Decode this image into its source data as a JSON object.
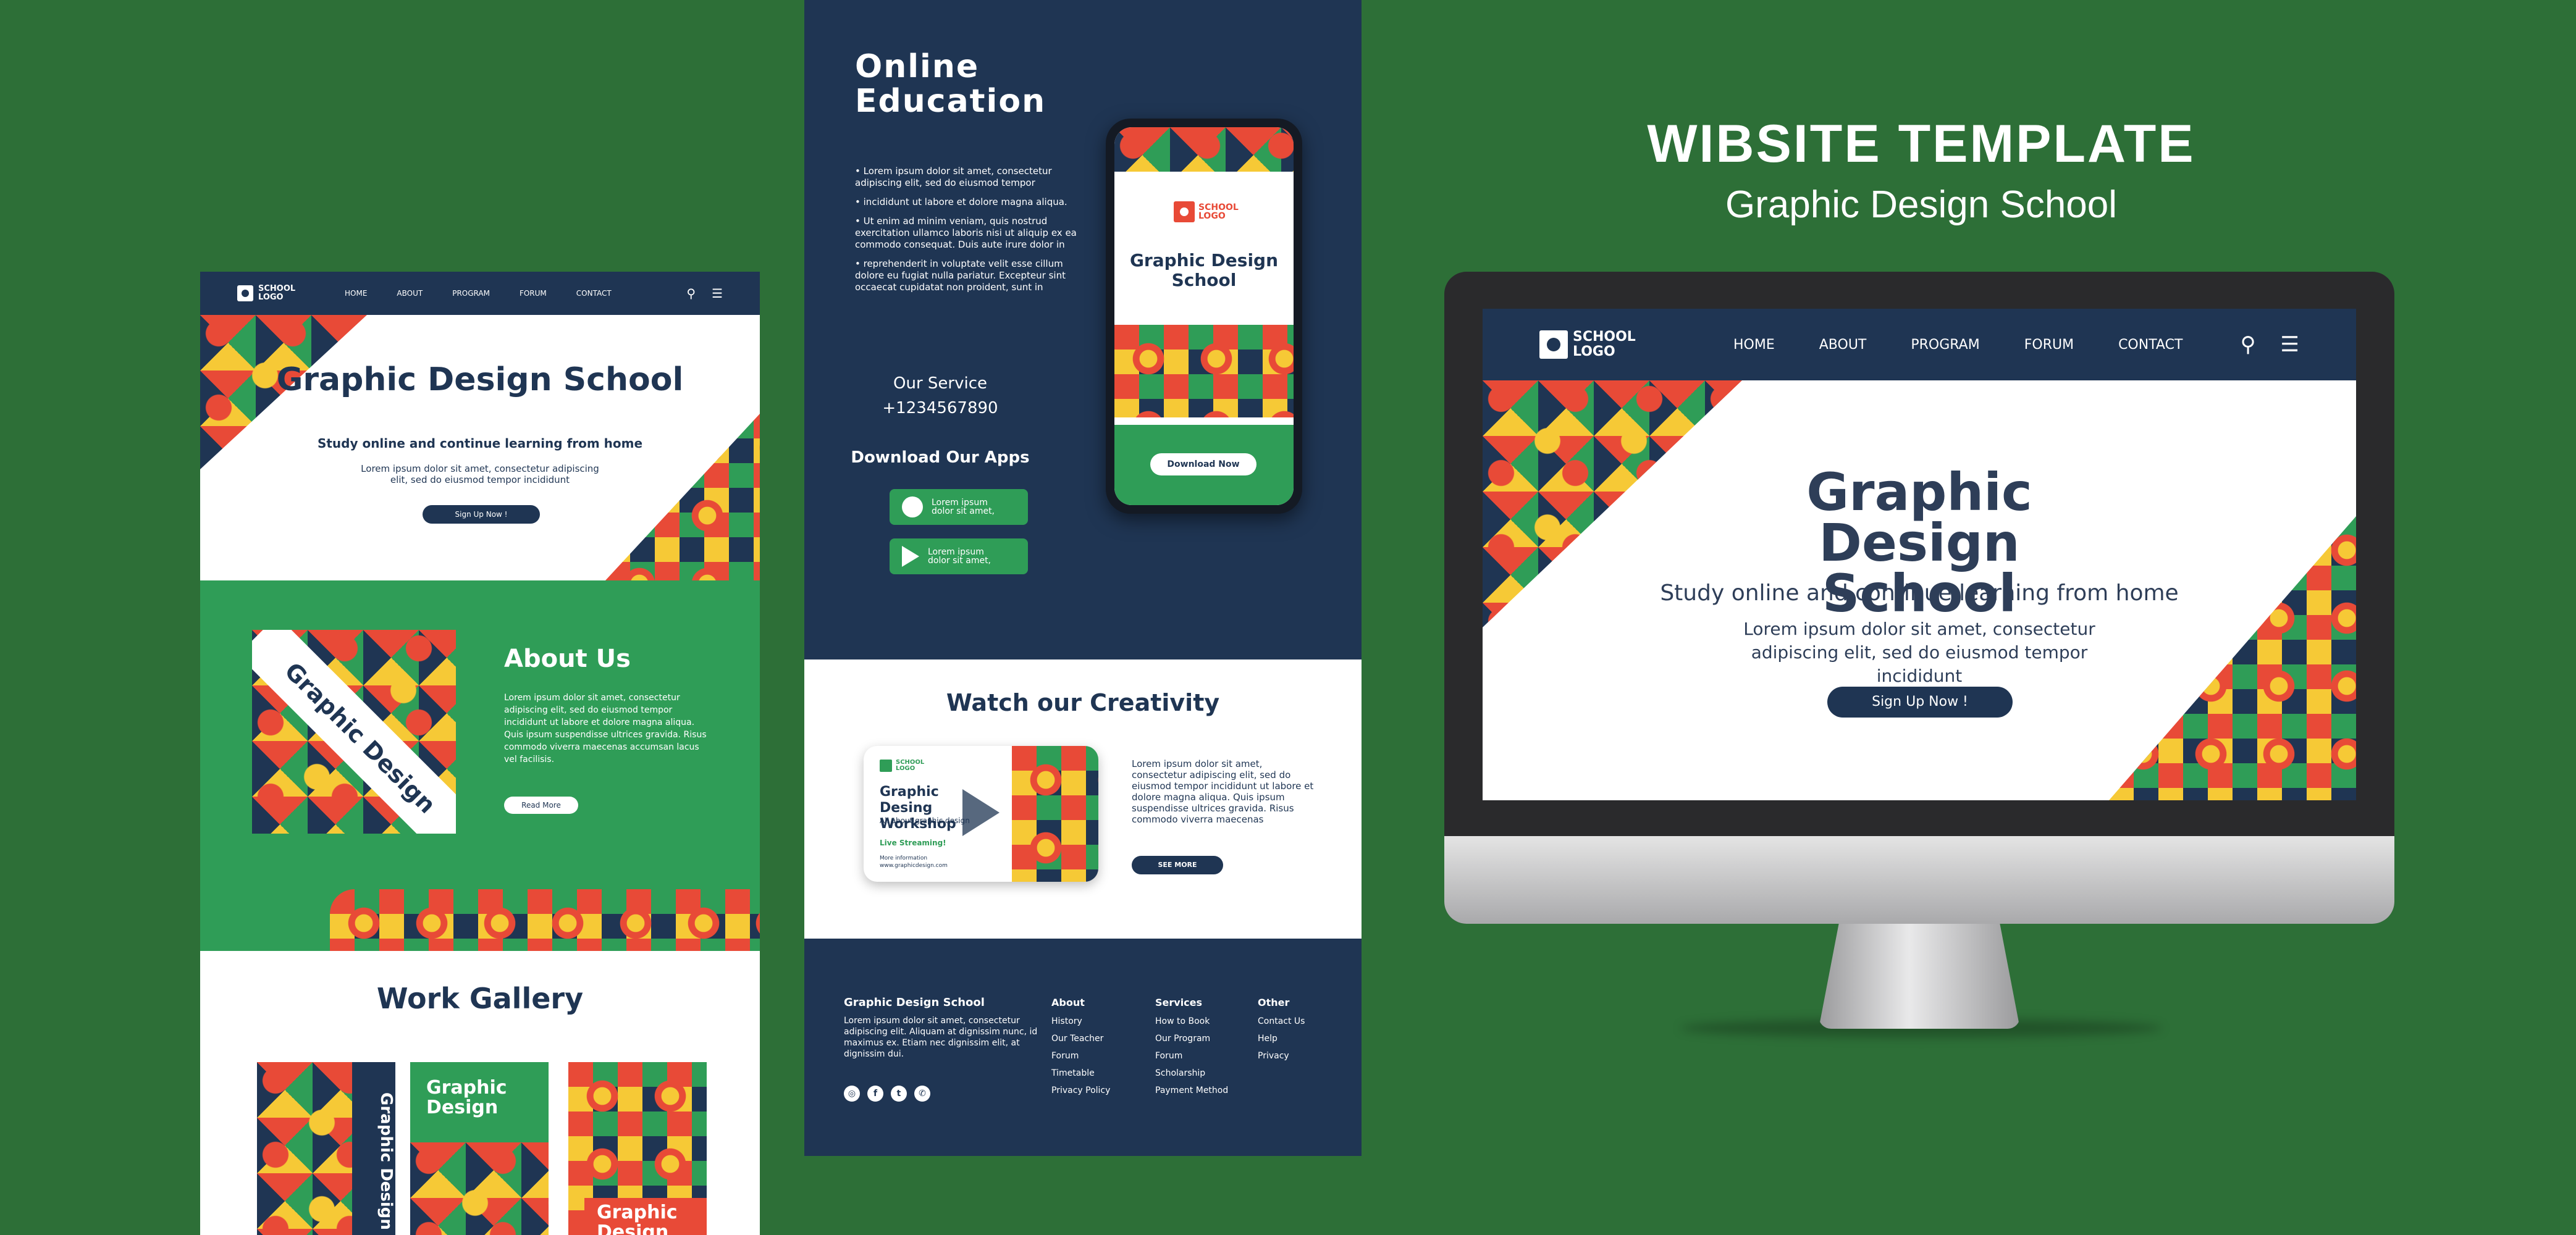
{
  "colors": {
    "background": "#2d6f37",
    "navy": "#1f3553",
    "green": "#2f9d57",
    "red": "#e84a37",
    "yellow": "#f6c936"
  },
  "icons": {
    "search": "search-icon",
    "menu": "hamburger-menu-icon",
    "play": "play-icon"
  },
  "logo": {
    "text": "SCHOOL LOGO"
  },
  "nav": {
    "home": "HOME",
    "about": "ABOUT",
    "program": "PROGRAM",
    "forum": "FORUM",
    "contact": "CONTACT"
  },
  "hero": {
    "title": "Graphic Design School",
    "subtitle": "Study online and continue learning from home",
    "lorem": "Lorem ipsum dolor sit amet, consectetur adipiscing elit, sed do eiusmod tempor incididunt",
    "button": "Sign Up Now !"
  },
  "about": {
    "image_text": "Graphic Design",
    "title": "About Us",
    "text": "Lorem ipsum dolor sit amet, consectetur adipiscing elit, sed do eiusmod tempor incididunt ut labore et dolore magna aliqua. Quis ipsum suspendisse ultrices gravida. Risus commodo viverra maecenas accumsan lacus vel facilisis.",
    "button": "Read More"
  },
  "gallery": {
    "title": "Work Gallery",
    "card1": "Graphic Design",
    "card2": "Graphic Design",
    "card3": "Graphic Design"
  },
  "online": {
    "title": "Online Education",
    "bullets": [
      "• Lorem ipsum dolor sit amet, consectetur adipiscing elit, sed do eiusmod tempor",
      "• incididunt ut labore et dolore magna aliqua.",
      "• Ut enim ad minim veniam, quis nostrud exercitation ullamco laboris nisi ut aliquip ex ea commodo consequat. Duis aute irure dolor in",
      "• reprehenderit in voluptate velit esse cillum dolore eu fugiat nulla pariatur. Excepteur sint occaecat cupidatat non proident, sunt in"
    ],
    "service_label": "Our Service",
    "phone": "+1234567890",
    "apps_label": "Download Our Apps",
    "app_button_1": "Lorem ipsum dolor sit amet,",
    "app_button_2": "Lorem ipsum dolor sit amet,"
  },
  "phone_screen": {
    "logo": "SCHOOL LOGO",
    "title": "Graphic Design School",
    "button": "Download Now"
  },
  "creativity": {
    "title": "Watch our Creativity",
    "video_title": "Graphic Desing Workshop",
    "video_sub": "All about graphic design",
    "video_live": "Live Streaming!",
    "video_web": "More information www.graphicdesign.com",
    "text": "Lorem ipsum dolor sit amet, consectetur adipiscing elit, sed do eiusmod tempor incididunt ut labore et dolore magna aliqua. Quis ipsum suspendisse ultrices gravida. Risus commodo viverra maecenas",
    "button": "SEE MORE"
  },
  "footer": {
    "brand": "Graphic Design School",
    "brand_text": "Lorem ipsum dolor sit amet, consectetur adipiscing elit. Aliquam at dignissim nunc, id maximus ex. Etiam nec dignissim elit, at dignissim dui.",
    "about_title": "About",
    "about_items": [
      "History",
      "Our Teacher",
      "Forum",
      "Timetable",
      "Privacy Policy"
    ],
    "services_title": "Services",
    "services_items": [
      "How to Book",
      "Our Program",
      "Forum",
      "Scholarship",
      "Payment Method"
    ],
    "other_title": "Other",
    "other_items": [
      "Contact Us",
      "Help",
      "Privacy"
    ],
    "social_icons": [
      "instagram-icon",
      "facebook-icon",
      "twitter-icon",
      "whatsapp-icon"
    ]
  },
  "heading": {
    "line1": "WIBSITE TEMPLATE",
    "line2": "Graphic Design School"
  }
}
